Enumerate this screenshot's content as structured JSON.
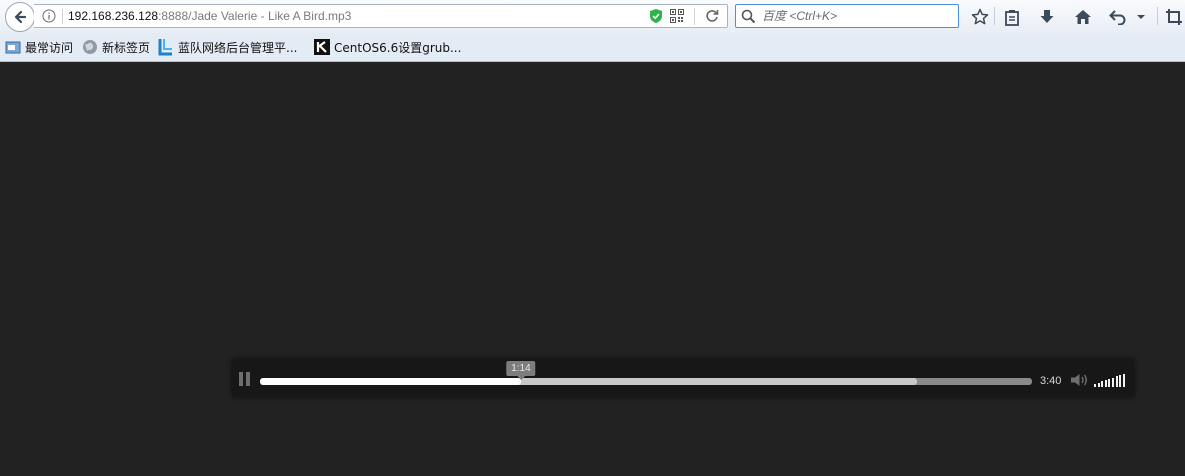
{
  "toolbar": {
    "url_host": "192.168.236.128",
    "url_rest": ":8888/Jade Valerie - Like A Bird.mp3",
    "search_placeholder": "百度 <Ctrl+K>"
  },
  "bookmarks": [
    {
      "label": "最常访问",
      "icon": "folder-icon"
    },
    {
      "label": "新标签页",
      "icon": "globe-icon"
    },
    {
      "label": "蓝队网络后台管理平...",
      "icon": "l-logo-icon"
    },
    {
      "label": "CentOS6.6设置grub...",
      "icon": "k-logo-icon"
    }
  ],
  "player": {
    "current_time_tooltip": "1:14",
    "duration": "3:40",
    "played_fraction": 0.338,
    "buffered_fraction": 0.851,
    "volume_fraction": 1.0
  },
  "colors": {
    "page_background": "#232323",
    "player_background": "#171717",
    "progress_played": "#ffffff",
    "progress_buffered": "#c9c9c9",
    "progress_track": "#8a8a8a"
  }
}
